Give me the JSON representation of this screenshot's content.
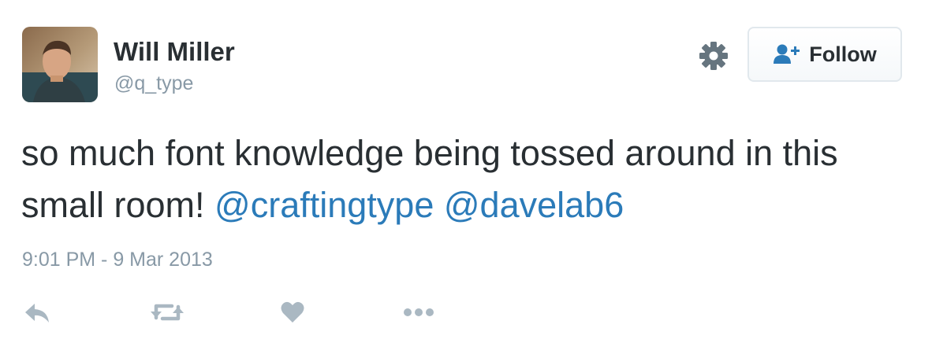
{
  "user": {
    "name": "Will Miller",
    "handle": "@q_type"
  },
  "header": {
    "settings_icon": "gear-icon",
    "follow_icon": "user-plus-icon",
    "follow_label": "Follow"
  },
  "tweet": {
    "text_part1": "so much font knowledge being tossed around in this small room! ",
    "mention1": "@craftingtype",
    "text_sep": " ",
    "mention2": "@davelab6",
    "timestamp": "9:01 PM - 9 Mar 2013"
  },
  "actions": [
    {
      "icon": "reply-icon"
    },
    {
      "icon": "retweet-icon"
    },
    {
      "icon": "like-heart-icon"
    },
    {
      "icon": "more-dots-icon"
    }
  ],
  "colors": {
    "text": "#292f33",
    "secondary": "#8899a6",
    "link": "#2b7bb9",
    "follow_icon": "#2b7bb9",
    "action_icon": "#aab8c2",
    "button_border": "#e1e8ed"
  }
}
